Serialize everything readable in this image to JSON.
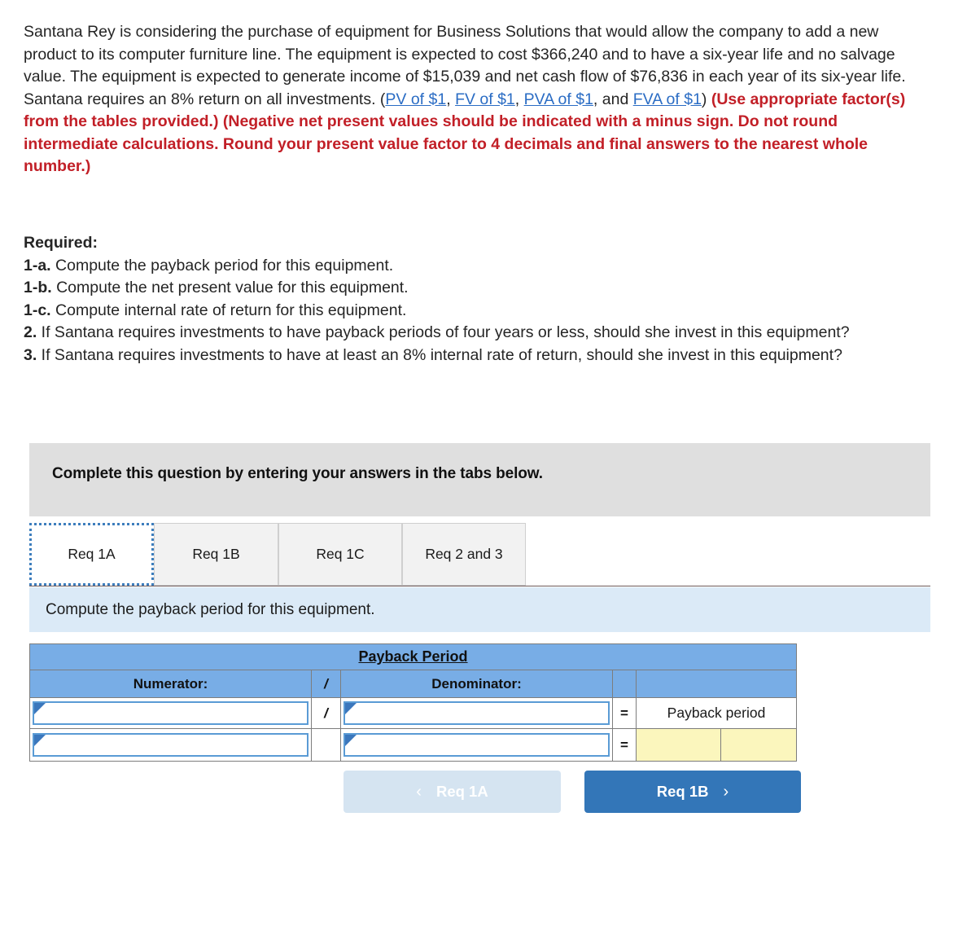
{
  "statement": {
    "part1": "Santana Rey is considering the purchase of equipment for Business Solutions that would allow the company to add a new product to its computer furniture line. The equipment is expected to cost $366,240 and to have a six-year life and no salvage value. The equipment is expected to generate income of $15,039 and net cash flow of $76,836 in each year of its six-year life. Santana requires an 8% return on all investments. (",
    "links": [
      "PV of $1",
      "FV of $1",
      "PVA of $1",
      "FVA of $1"
    ],
    "sep_comma": ", ",
    "sep_and": ", and ",
    "close_paren": ") ",
    "red_note": "(Use appropriate factor(s) from the tables provided.) (Negative net present values should be indicated with a minus sign. Do not round intermediate calculations. Round your present value factor to 4 decimals and final answers to the nearest whole number.)"
  },
  "required": {
    "heading": "Required:",
    "items": [
      {
        "num": "1-a.",
        "text": " Compute the payback period for this equipment."
      },
      {
        "num": "1-b.",
        "text": " Compute the net present value for this equipment."
      },
      {
        "num": "1-c.",
        "text": " Compute internal rate of return for this equipment."
      },
      {
        "num": "2.",
        "text": " If Santana requires investments to have payback periods of four years or less, should she invest in this equipment?"
      },
      {
        "num": "3.",
        "text": " If Santana requires investments to have at least an 8% internal rate of return, should she invest in this equipment?"
      }
    ]
  },
  "banner": {
    "text": "Complete this question by entering your answers in the tabs below."
  },
  "tabs": [
    {
      "label": "Req 1A",
      "active": true
    },
    {
      "label": "Req 1B",
      "active": false
    },
    {
      "label": "Req 1C",
      "active": false
    },
    {
      "label": "Req 2 and 3",
      "active": false
    }
  ],
  "instruction": {
    "text": "Compute the payback period for this equipment."
  },
  "table": {
    "title": "Payback Period",
    "columns": {
      "numerator": "Numerator:",
      "slash": "/",
      "denominator": "Denominator:",
      "blank1": "",
      "blank2": ""
    },
    "rows": [
      {
        "numerator_value": "",
        "slash": "/",
        "denominator_value": "",
        "equals": "=",
        "result_label": "Payback period"
      },
      {
        "numerator_value": "",
        "slash": "",
        "denominator_value": "",
        "equals": "=",
        "answer_left": "",
        "answer_right": ""
      }
    ]
  },
  "nav": {
    "prev_label": "Req 1A",
    "prev_chevron": "‹",
    "next_label": "Req 1B",
    "next_chevron": "›"
  },
  "colors": {
    "red_note": "#c21f27",
    "link": "#2a6cc4",
    "table_header_blue": "#78ade6",
    "answer_yellow": "#fbf6bd",
    "instruction_blue": "#dbeaf7",
    "banner_gray": "#dfdfdf",
    "next_button_blue": "#3376b8",
    "prev_button_blue": "#d5e4f1",
    "input_border_blue": "#5a9bd5"
  }
}
